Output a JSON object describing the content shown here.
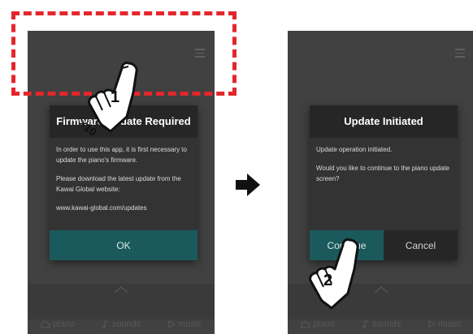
{
  "left_screen": {
    "dialog": {
      "title": "Firmware Update Required",
      "paragraphs": [
        "In order to use this app, it is first necessary to update the piano's firmware.",
        "Please download the latest update from the Kawai Global website:",
        "www.kawai-global.com/updates"
      ],
      "ok_label": "OK"
    },
    "tabs": [
      "piano",
      "sounds",
      "music"
    ]
  },
  "right_screen": {
    "dialog": {
      "title": "Update Initiated",
      "paragraphs": [
        "Update operation initiated.",
        "Would you like to continue to the piano update screen?"
      ],
      "continue_label": "Continue",
      "cancel_label": "Cancel"
    },
    "tabs": [
      "piano",
      "sounds",
      "music"
    ]
  },
  "step_labels": {
    "step1": "1",
    "step2": "2",
    "tap_count": "×10"
  },
  "colors": {
    "highlight": "#e4262d",
    "accent": "#1b5a5c",
    "arrow": "#111111"
  },
  "icons": [
    "menu-icon",
    "chevron-up-icon",
    "piano-icon",
    "sounds-icon",
    "music-icon",
    "arrow-right-icon",
    "hand-pointer-icon"
  ]
}
